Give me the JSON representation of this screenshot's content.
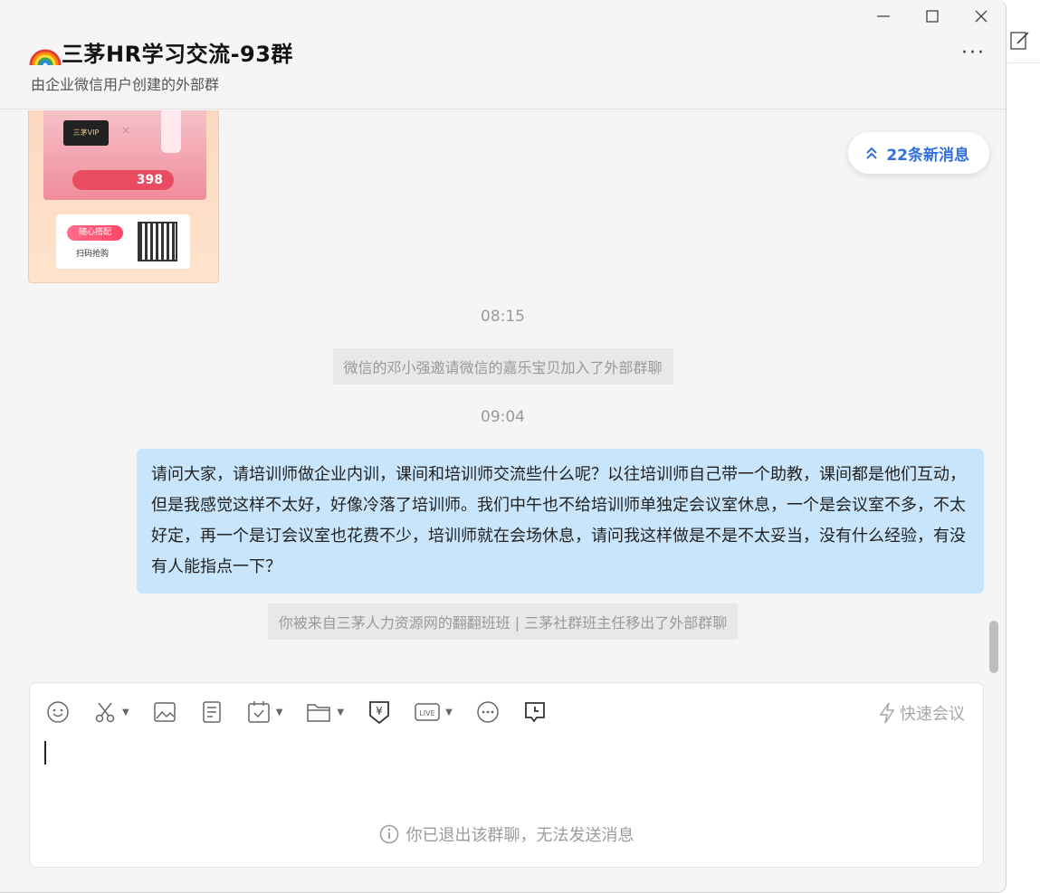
{
  "header": {
    "title": "三茅HR学习交流-93群",
    "subtitle": "由企业微信用户创建的外部群",
    "more_label": "···"
  },
  "poster": {
    "card_text": "三茅VIP",
    "plus": "×",
    "price": "398",
    "buy_label": "随心搭配",
    "scan_label": "扫码抢购"
  },
  "new_messages": {
    "label": "22条新消息"
  },
  "messages": {
    "time1": "08:15",
    "system1": "微信的邓小强邀请微信的嘉乐宝贝加入了外部群聊",
    "time2": "09:04",
    "bubble": "请问大家，请培训师做企业内训，课间和培训师交流些什么呢？以往培训师自己带一个助教，课间都是他们互动，但是我感觉这样不太好，好像冷落了培训师。我们中午也不给培训师单独定会议室休息，一个是会议室不多，不太好定，再一个是订会议室也花费不少，培训师就在会场休息，请问我这样做是不是不太妥当，没有什么经验，有没有人能指点一下？",
    "system2": "你被来自三茅人力资源网的翻翻班班 | 三茅社群班主任移出了外部群聊"
  },
  "composer": {
    "quick_meeting": "快速会议",
    "exited_notice": "你已退出该群聊，无法发送消息",
    "icons": [
      "emoji-icon",
      "scissors-icon",
      "image-icon",
      "document-icon",
      "calendar-check-icon",
      "folder-icon",
      "red-packet-icon",
      "live-icon",
      "more-circle-icon",
      "chat-history-icon"
    ]
  },
  "colors": {
    "bubble": "#c9e5fb",
    "accent": "#2f6fe0",
    "background": "#f5f5f5"
  }
}
